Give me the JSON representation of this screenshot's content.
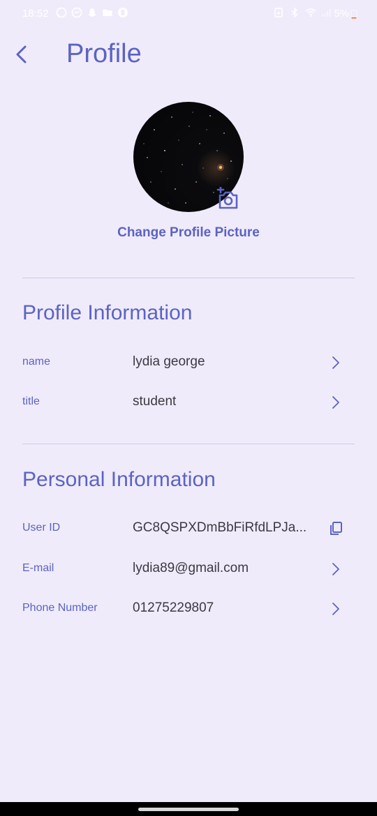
{
  "status_bar": {
    "time": "18:52",
    "battery_percent": "5%",
    "battery_color": "#FF5A2B"
  },
  "header": {
    "title": "Profile",
    "back_icon": "chevron-left-icon"
  },
  "avatar": {
    "change_label": "Change Profile Picture",
    "camera_icon": "add-photo-icon"
  },
  "sections": {
    "profile_information": {
      "title": "Profile Information",
      "rows": [
        {
          "label": "name",
          "value": "lydia george",
          "icon": "chevron-right-icon"
        },
        {
          "label": "title",
          "value": "student",
          "icon": "chevron-right-icon"
        }
      ]
    },
    "personal_information": {
      "title": "Personal Information",
      "rows": [
        {
          "label": "User ID",
          "value": "GC8QSPXDmBbFiRfdLPJa...",
          "icon": "copy-icon"
        },
        {
          "label": "E-mail",
          "value": "lydia89@gmail.com",
          "icon": "chevron-right-icon"
        },
        {
          "label": "Phone Number",
          "value": "01275229807",
          "icon": "chevron-right-icon"
        }
      ]
    }
  },
  "colors": {
    "background": "#F0EBFA",
    "accent": "#5B63C4",
    "text": "#3A3A42",
    "divider": "#CDC7EC"
  }
}
